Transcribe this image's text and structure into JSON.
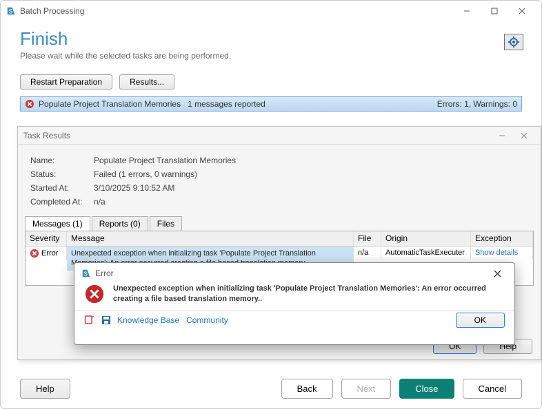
{
  "window": {
    "title": "Batch Processing"
  },
  "header": {
    "title": "Finish",
    "subtitle": "Please wait while the selected tasks are being performed."
  },
  "toolbar": {
    "restart_label": "Restart Preparation",
    "results_label": "Results..."
  },
  "task_summary": {
    "name": "Populate Project Translation Memories",
    "msg_count": "1 messages reported",
    "counts": "Errors: 1, Warnings: 0"
  },
  "task_results": {
    "panel_title": "Task Results",
    "rows": {
      "name_label": "Name:",
      "name_value": "Populate Project Translation Memories",
      "status_label": "Status:",
      "status_value": "Failed (1 errors, 0 warnings)",
      "started_label": "Started At:",
      "started_value": "3/10/2025 9:10:52 AM",
      "completed_label": "Completed At:",
      "completed_value": "n/a"
    },
    "tabs": {
      "messages": "Messages (1)",
      "reports": "Reports (0)",
      "files": "Files"
    },
    "grid": {
      "headers": {
        "severity": "Severity",
        "message": "Message",
        "file": "File",
        "origin": "Origin",
        "exception": "Exception"
      },
      "row0": {
        "severity": "Error",
        "message": "Unexpected exception when initializing task 'Populate Project Translation Memories': An error occurred creating a file based translation memory..",
        "file": "n/a",
        "origin": "AutomaticTaskExecuter",
        "exception": "Show details"
      }
    },
    "footer": {
      "ok": "OK",
      "help": "Help"
    }
  },
  "error_dialog": {
    "title": "Error",
    "message": "Unexpected exception when initializing task 'Populate Project Translation Memories': An error occurred creating a file based translation memory..",
    "links": {
      "kb": "Knowledge Base",
      "community": "Community"
    },
    "ok": "OK"
  },
  "outer_footer": {
    "help": "Help",
    "back": "Back",
    "next": "Next",
    "close": "Close",
    "cancel": "Cancel"
  }
}
